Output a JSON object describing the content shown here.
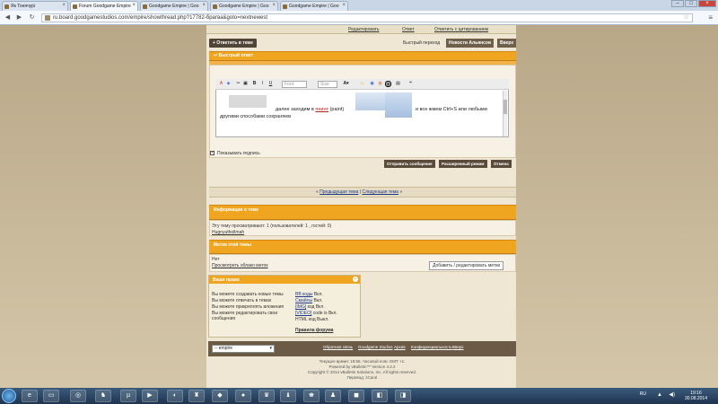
{
  "browser": {
    "tabs": [
      {
        "label": "Як Тонячурі"
      },
      {
        "label": "Forum Goodgame Empire"
      },
      {
        "label": "Goodgame Empire | Goo"
      },
      {
        "label": "Goodgame Empire | Goo"
      },
      {
        "label": "Goodgame Empire | Goo"
      }
    ],
    "url": "ru.board.goodgamestudios.com/empire/showthread.php?17782-брагва&goto=nextnewest"
  },
  "thread_controls": {
    "edit": "Редактировать",
    "reply": "Ответ",
    "reply_quote": "Ответить с цитированием",
    "reply_thread_button": "+ Ответить в теме",
    "quick_nav": "Быстрый переход",
    "nav_select": "Новости Альянсов",
    "nav_go": "Вверх"
  },
  "quick_reply": {
    "header": "Быстрый ответ",
    "font_select": "Font",
    "size_select": "Size",
    "editor_text": "далее заходим в",
    "editor_link": "пеинт",
    "editor_text2": "(paint)",
    "editor_text3": "и все жмем Ctrl+S или любыми",
    "editor_text4": "другими способами сохраняем",
    "show_signature": "Показывать подпись",
    "btn_send": "Отправить сообщение",
    "btn_advanced": "Расширенный режим",
    "btn_cancel": "Отмена"
  },
  "thread_nav": {
    "prev": "Предыдущая тема",
    "sep": "|",
    "next": "Следующая тема"
  },
  "thread_info": {
    "header": "Информация о теме",
    "viewers": "Эту тему просматривают: 1 (пользователей: 1 , гостей: 0)",
    "user": "Hugnyuthollmah"
  },
  "tags": {
    "header": "Метки этой темы",
    "none": "Нет",
    "cloud": "Просмотреть облако меток",
    "edit_button": "Добавить / редактировать метки"
  },
  "rights": {
    "header": "Ваши права",
    "rows": [
      {
        "left": "Вы можете создавать новые темы",
        "right_link": "BB коды",
        "right": "Вкл."
      },
      {
        "left": "Вы можете отвечать в темах",
        "right_link": "Смайлы",
        "right": "Вкл."
      },
      {
        "left": "Вы можете прикреплять вложения",
        "right_link": "[IMG]",
        "right": "код Вкл."
      },
      {
        "left": "Вы можете редактировать свои",
        "right_link": "[VIDEO]",
        "right": "code is Вкл."
      },
      {
        "left": "сообщения",
        "right_link": "",
        "right": "HTML код Выкл."
      }
    ],
    "rules_link": "Правила форума"
  },
  "footer": {
    "select": "-- empire",
    "links": [
      "Обратная связь",
      "Goodgame Studios",
      "Архив",
      "Конфиденциальность",
      "Вверх"
    ],
    "timezone": "Текущее время: 18:55. Часовой пояс GMT +1.",
    "powered": "Powered by vBulletin™ Version 4.2.2",
    "copyright": "Copyright © 2014 vBulletin Solutions, Inc. All rights reserved.",
    "translation": "Перевод: zCarol"
  },
  "taskbar": {
    "lang": "RU",
    "time": "19:16",
    "date": "30.08.2014"
  }
}
